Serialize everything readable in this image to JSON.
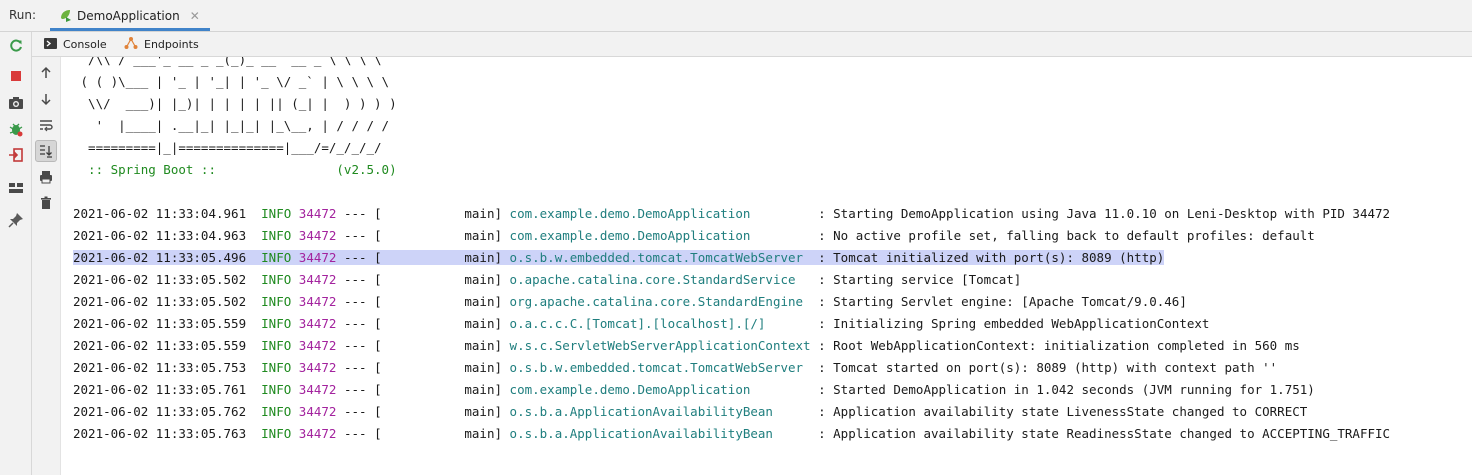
{
  "run": {
    "label": "Run:",
    "tab_label": "DemoApplication",
    "close_glyph": "✕"
  },
  "tabs": {
    "console": "Console",
    "endpoints": "Endpoints"
  },
  "icons": {
    "left": [
      "rerun-icon",
      "stop-icon",
      "camera-icon",
      "debug-icon",
      "exit-icon",
      "layout-icon",
      "pin-icon"
    ],
    "sub": [
      "up-arrow-icon",
      "down-arrow-icon",
      "soft-wrap-icon",
      "scroll-to-end-icon",
      "print-icon",
      "clear-icon"
    ]
  },
  "banner": [
    "  /\\\\ / ___'_ __ _ _(_)_ __  __ _ \\ \\ \\ \\",
    " ( ( )\\___ | '_ | '_| | '_ \\/ _` | \\ \\ \\ \\",
    "  \\\\/  ___)| |_)| | | | | || (_| |  ) ) ) )",
    "   '  |____| .__|_| |_|_| |_\\__, | / / / /",
    "  =========|_|==============|___/=/_/_/_/",
    "  :: Spring Boot ::                (v2.5.0)"
  ],
  "logs": [
    {
      "time": "2021-06-02 11:33:04.961",
      "level": "INFO",
      "pid": "34472",
      "sep": " --- [",
      "thread": "           main]",
      "logger": "com.example.demo.DemoApplication        ",
      "message": " : Starting DemoApplication using Java 11.0.10 on Leni-Desktop with PID 34472"
    },
    {
      "time": "2021-06-02 11:33:04.963",
      "level": "INFO",
      "pid": "34472",
      "sep": " --- [",
      "thread": "           main]",
      "logger": "com.example.demo.DemoApplication        ",
      "message": " : No active profile set, falling back to default profiles: default"
    },
    {
      "time": "2021-06-02 11:33:05.496",
      "level": "INFO",
      "pid": "34472",
      "sep": " --- [",
      "thread": "           main]",
      "logger": "o.s.b.w.embedded.tomcat.TomcatWebServer ",
      "message": " : Tomcat initialized with port(s): 8089 (http)"
    },
    {
      "time": "2021-06-02 11:33:05.502",
      "level": "INFO",
      "pid": "34472",
      "sep": " --- [",
      "thread": "           main]",
      "logger": "o.apache.catalina.core.StandardService  ",
      "message": " : Starting service [Tomcat]"
    },
    {
      "time": "2021-06-02 11:33:05.502",
      "level": "INFO",
      "pid": "34472",
      "sep": " --- [",
      "thread": "           main]",
      "logger": "org.apache.catalina.core.StandardEngine ",
      "message": " : Starting Servlet engine: [Apache Tomcat/9.0.46]"
    },
    {
      "time": "2021-06-02 11:33:05.559",
      "level": "INFO",
      "pid": "34472",
      "sep": " --- [",
      "thread": "           main]",
      "logger": "o.a.c.c.C.[Tomcat].[localhost].[/]      ",
      "message": " : Initializing Spring embedded WebApplicationContext"
    },
    {
      "time": "2021-06-02 11:33:05.559",
      "level": "INFO",
      "pid": "34472",
      "sep": " --- [",
      "thread": "           main]",
      "logger": "w.s.c.ServletWebServerApplicationContext",
      "message": " : Root WebApplicationContext: initialization completed in 560 ms"
    },
    {
      "time": "2021-06-02 11:33:05.753",
      "level": "INFO",
      "pid": "34472",
      "sep": " --- [",
      "thread": "           main]",
      "logger": "o.s.b.w.embedded.tomcat.TomcatWebServer ",
      "message": " : Tomcat started on port(s): 8089 (http) with context path ''"
    },
    {
      "time": "2021-06-02 11:33:05.761",
      "level": "INFO",
      "pid": "34472",
      "sep": " --- [",
      "thread": "           main]",
      "logger": "com.example.demo.DemoApplication        ",
      "message": " : Started DemoApplication in 1.042 seconds (JVM running for 1.751)"
    },
    {
      "time": "2021-06-02 11:33:05.762",
      "level": "INFO",
      "pid": "34472",
      "sep": " --- [",
      "thread": "           main]",
      "logger": "o.s.b.a.ApplicationAvailabilityBean     ",
      "message": " : Application availability state LivenessState changed to CORRECT"
    },
    {
      "time": "2021-06-02 11:33:05.763",
      "level": "INFO",
      "pid": "34472",
      "sep": " --- [",
      "thread": "           main]",
      "logger": "o.s.b.a.ApplicationAvailabilityBean     ",
      "message": " : Application availability state ReadinessState changed to ACCEPTING_TRAFFIC"
    }
  ],
  "highlight_index": 2,
  "colors": {
    "info": "#1f8a1f",
    "pid": "#a3239e",
    "logger": "#1f7e7e",
    "highlight": "#cdd3f8",
    "tab_underline": "#4083c9"
  }
}
